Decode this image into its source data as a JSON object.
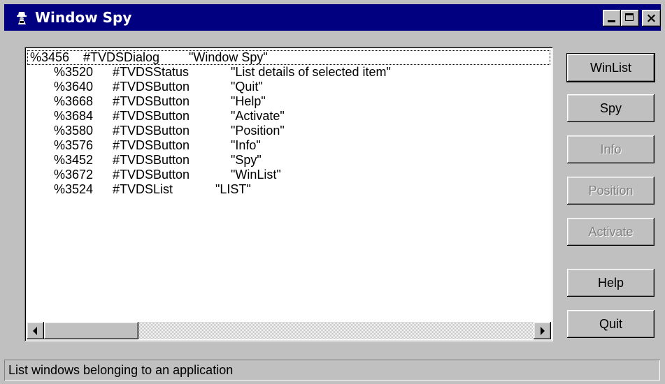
{
  "window": {
    "title": "Window Spy",
    "icon": "spy-icon",
    "controls": {
      "minimize": "minimize-icon",
      "maximize": "maximize-icon",
      "close": "×"
    }
  },
  "list": {
    "items": [
      {
        "id": "%3456",
        "cls": "#TVDSDialog",
        "text": "\"Window Spy\""
      },
      {
        "id": "%3520",
        "cls": "#TVDSStatus",
        "text": "\"List details of selected item\""
      },
      {
        "id": "%3640",
        "cls": "#TVDSButton",
        "text": "\"Quit\""
      },
      {
        "id": "%3668",
        "cls": "#TVDSButton",
        "text": "\"Help\""
      },
      {
        "id": "%3684",
        "cls": "#TVDSButton",
        "text": "\"Activate\""
      },
      {
        "id": "%3580",
        "cls": "#TVDSButton",
        "text": "\"Position\""
      },
      {
        "id": "%3576",
        "cls": "#TVDSButton",
        "text": "\"Info\""
      },
      {
        "id": "%3452",
        "cls": "#TVDSButton",
        "text": "\"Spy\""
      },
      {
        "id": "%3672",
        "cls": "#TVDSButton",
        "text": "\"WinList\""
      },
      {
        "id": "%3524",
        "cls": "#TVDSList",
        "text": "\"LIST\""
      }
    ]
  },
  "buttons": {
    "winlist": "WinList",
    "spy": "Spy",
    "info": "Info",
    "position": "Position",
    "activate": "Activate",
    "help": "Help",
    "quit": "Quit"
  },
  "status": {
    "text": "List windows belonging to an application"
  },
  "colors": {
    "face": "#c0c0c0",
    "title_bar": "#000080",
    "title_text": "#ffffff",
    "list_bg": "#ffffff",
    "disabled_text": "#808080"
  }
}
